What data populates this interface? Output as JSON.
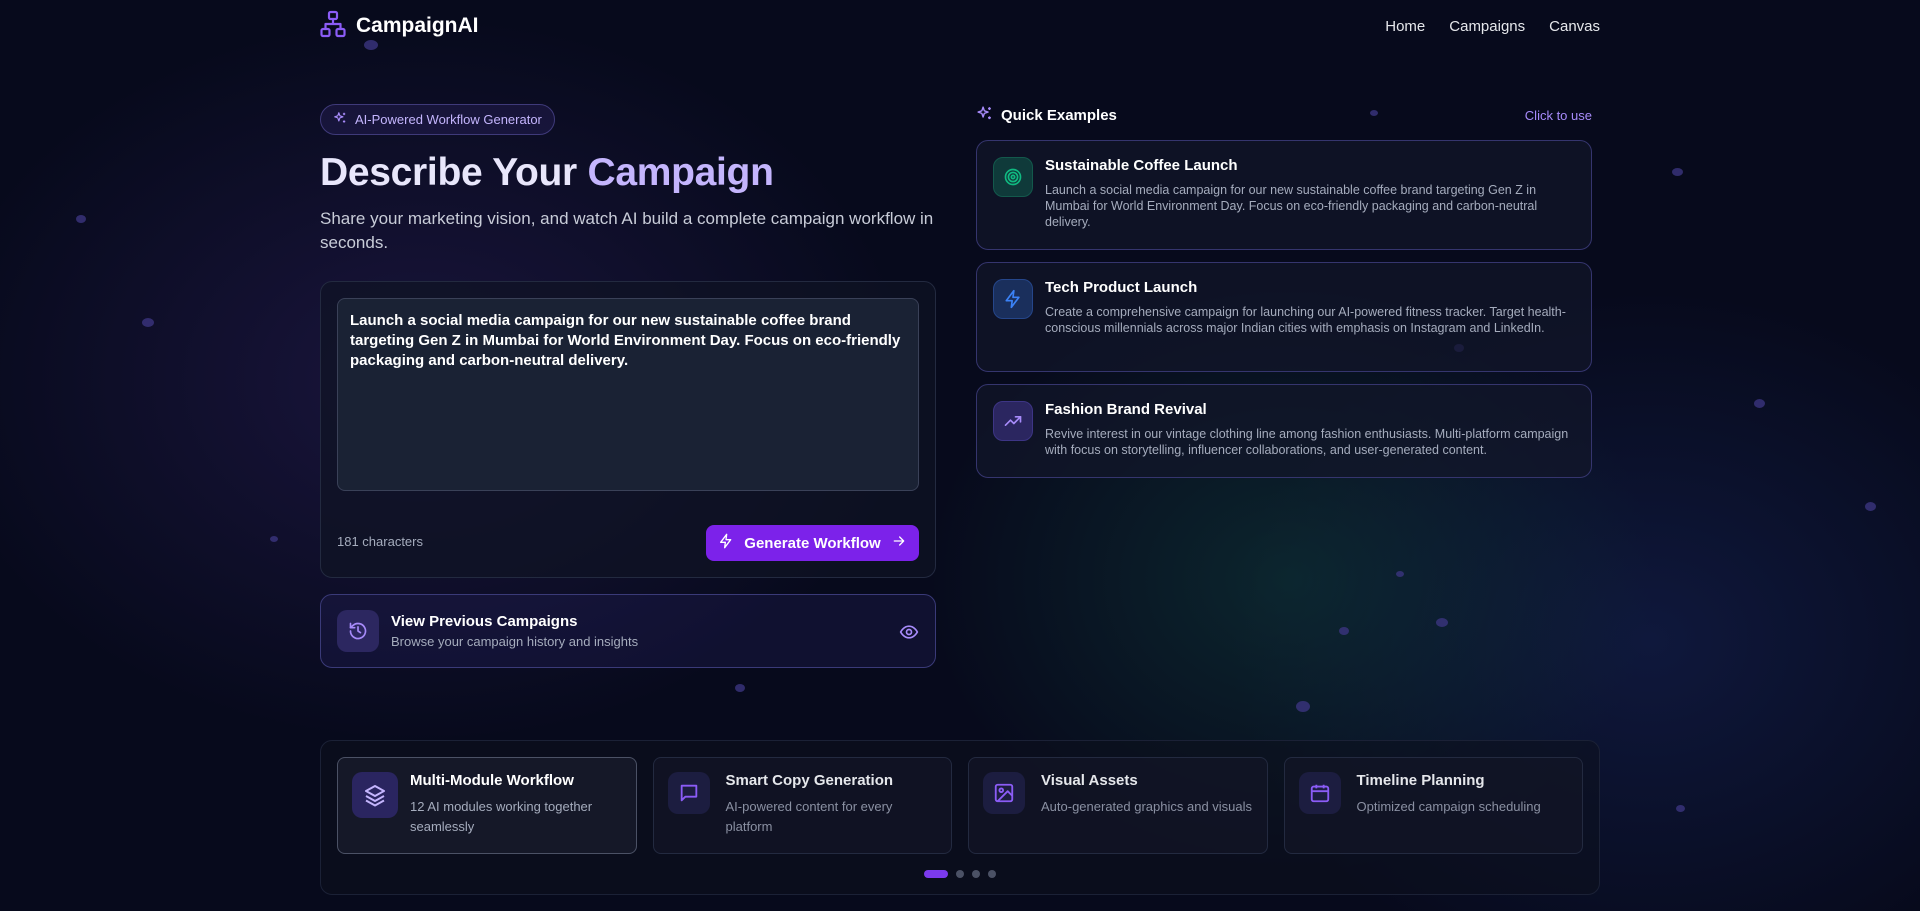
{
  "brand": {
    "name": "CampaignAI",
    "icon": "network-icon"
  },
  "nav": {
    "items": [
      "Home",
      "Campaigns",
      "Canvas"
    ]
  },
  "hero": {
    "badge": "AI-Powered Workflow Generator",
    "title_main": "Describe Your ",
    "title_accent": "Campaign",
    "subtitle": "Share your marketing vision, and watch AI build a complete campaign workflow in seconds."
  },
  "composer": {
    "text": "Launch a social media campaign for our new sustainable coffee brand targeting Gen Z in Mumbai for World Environment Day. Focus on eco-friendly packaging and carbon-neutral delivery.",
    "char_count": "181 characters",
    "generate_label": "Generate Workflow"
  },
  "previous": {
    "title": "View Previous Campaigns",
    "subtitle": "Browse your campaign history and insights"
  },
  "quick_examples": {
    "title": "Quick Examples",
    "hint": "Click to use",
    "items": [
      {
        "title": "Sustainable Coffee Launch",
        "description": "Launch a social media campaign for our new sustainable coffee brand targeting Gen Z in Mumbai for World Environment Day. Focus on eco-friendly packaging and carbon-neutral delivery.",
        "icon": "target-icon",
        "color": "#10b981"
      },
      {
        "title": "Tech Product Launch",
        "description": "Create a comprehensive campaign for launching our AI-powered fitness tracker. Target health-conscious millennials across major Indian cities with emphasis on Instagram and LinkedIn.",
        "icon": "bolt-icon",
        "color": "#3b82f6"
      },
      {
        "title": "Fashion Brand Revival",
        "description": "Revive interest in our vintage clothing line among fashion enthusiasts. Multi-platform campaign with focus on storytelling, influencer collaborations, and user-generated content.",
        "icon": "trending-up-icon",
        "color": "#8b5cf6"
      }
    ]
  },
  "features": {
    "items": [
      {
        "title": "Multi-Module Workflow",
        "description": "12 AI modules working together seamlessly",
        "icon": "layers-icon"
      },
      {
        "title": "Smart Copy Generation",
        "description": "AI-powered content for every platform",
        "icon": "chat-icon"
      },
      {
        "title": "Visual Assets",
        "description": "Auto-generated graphics and visuals",
        "icon": "image-icon"
      },
      {
        "title": "Timeline Planning",
        "description": "Optimized campaign scheduling",
        "icon": "calendar-icon"
      }
    ],
    "pagination": {
      "pages": 4,
      "active": 1
    }
  },
  "colors": {
    "accent": "#7c22ea",
    "accent_light": "#c4b5fd",
    "background": "#070a1c"
  }
}
